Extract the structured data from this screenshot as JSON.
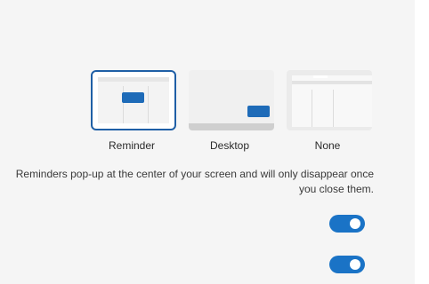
{
  "popup_style": {
    "selected": "Reminder",
    "options": [
      {
        "label": "Reminder"
      },
      {
        "label": "Desktop"
      },
      {
        "label": "None"
      }
    ]
  },
  "description": "Reminders pop-up at the center of your screen and will only disappear once you close them.",
  "toggles": [
    {
      "state": "on"
    },
    {
      "state": "on"
    }
  ],
  "colors": {
    "accent": "#1a73c6",
    "panel_bg": "#f5f5f5",
    "selection_border": "#1f5fa6"
  }
}
